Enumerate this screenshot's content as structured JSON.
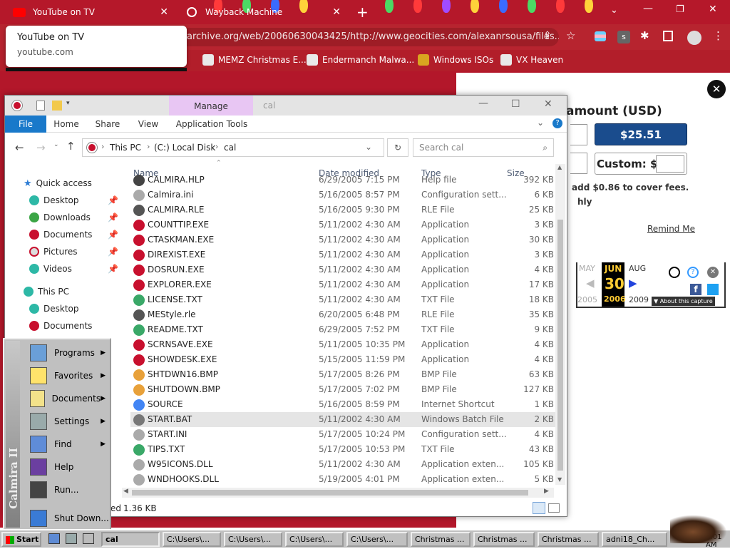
{
  "browser": {
    "tabs": [
      {
        "title": "YouTube on TV"
      },
      {
        "title": "Wayback Machine"
      }
    ],
    "hover_card": {
      "title": "YouTube on TV",
      "domain": "youtube.com"
    },
    "address": "archive.org/web/20060630043425/http://www.geocities.com/alexanrsousa/files...",
    "bookmarks": [
      "MEMZ Christmas E...",
      "Endermanch Malwa...",
      "Windows ISOs",
      "VX Heaven"
    ],
    "profile_initial": "s"
  },
  "webpage": {
    "amount_heading": "amount (USD)",
    "amount_button": "$25.51",
    "custom_label": "Custom: $",
    "fees_text": "add $0.86 to cover fees.",
    "monthly_text": "hly",
    "remind": "Remind Me",
    "wayback": {
      "prev_month": "MAY",
      "cur_month": "JUN",
      "next_month": "AUG",
      "day": "30",
      "prev_year": "2005",
      "cur_year": "2006",
      "next_year": "2009",
      "about": "About this capture"
    }
  },
  "explorer": {
    "title": "cal",
    "manage_tab": "Manage",
    "ribbon_tabs": [
      "File",
      "Home",
      "Share",
      "View",
      "Application Tools"
    ],
    "breadcrumb": [
      "This PC",
      "(C:) Local Disk",
      "cal"
    ],
    "search_placeholder": "Search cal",
    "columns": {
      "name": "Name",
      "date": "Date modified",
      "type": "Type",
      "size": "Size"
    },
    "nav": {
      "quick_access": "Quick access",
      "items": [
        "Desktop",
        "Downloads",
        "Documents",
        "Pictures",
        "Videos"
      ],
      "this_pc": "This PC",
      "pc_items": [
        "Desktop",
        "Documents"
      ]
    },
    "files": [
      {
        "name": "CALMIRA.HLP",
        "date": "6/29/2005 7:15 PM",
        "type": "Help file",
        "size": "392 KB"
      },
      {
        "name": "Calmira.ini",
        "date": "5/16/2005 8:57 PM",
        "type": "Configuration sett...",
        "size": "6 KB"
      },
      {
        "name": "CALMIRA.RLE",
        "date": "5/16/2005 9:30 PM",
        "type": "RLE File",
        "size": "25 KB"
      },
      {
        "name": "COUNTTIP.EXE",
        "date": "5/11/2002 4:30 AM",
        "type": "Application",
        "size": "3 KB"
      },
      {
        "name": "CTASKMAN.EXE",
        "date": "5/11/2002 4:30 AM",
        "type": "Application",
        "size": "30 KB"
      },
      {
        "name": "DIREXIST.EXE",
        "date": "5/11/2002 4:30 AM",
        "type": "Application",
        "size": "3 KB"
      },
      {
        "name": "DOSRUN.EXE",
        "date": "5/11/2002 4:30 AM",
        "type": "Application",
        "size": "4 KB"
      },
      {
        "name": "EXPLORER.EXE",
        "date": "5/11/2002 4:30 AM",
        "type": "Application",
        "size": "17 KB"
      },
      {
        "name": "LICENSE.TXT",
        "date": "5/11/2002 4:30 AM",
        "type": "TXT File",
        "size": "18 KB"
      },
      {
        "name": "MEStyle.rle",
        "date": "6/20/2005 6:48 PM",
        "type": "RLE File",
        "size": "35 KB"
      },
      {
        "name": "README.TXT",
        "date": "6/29/2005 7:52 PM",
        "type": "TXT File",
        "size": "9 KB"
      },
      {
        "name": "SCRNSAVE.EXE",
        "date": "5/11/2005 10:35 PM",
        "type": "Application",
        "size": "4 KB"
      },
      {
        "name": "SHOWDESK.EXE",
        "date": "5/15/2005 11:59 PM",
        "type": "Application",
        "size": "4 KB"
      },
      {
        "name": "SHTDWN16.BMP",
        "date": "5/17/2005 8:26 PM",
        "type": "BMP File",
        "size": "63 KB"
      },
      {
        "name": "SHUTDOWN.BMP",
        "date": "5/17/2005 7:02 PM",
        "type": "BMP File",
        "size": "127 KB"
      },
      {
        "name": "SOURCE",
        "date": "5/16/2005 8:59 PM",
        "type": "Internet Shortcut",
        "size": "1 KB"
      },
      {
        "name": "START.BAT",
        "date": "5/11/2002 4:30 AM",
        "type": "Windows Batch File",
        "size": "2 KB"
      },
      {
        "name": "START.INI",
        "date": "5/17/2005 10:24 PM",
        "type": "Configuration sett...",
        "size": "4 KB"
      },
      {
        "name": "TIPS.TXT",
        "date": "5/17/2005 10:53 PM",
        "type": "TXT File",
        "size": "43 KB"
      },
      {
        "name": "W95ICONS.DLL",
        "date": "5/11/2002 4:30 AM",
        "type": "Application exten...",
        "size": "105 KB"
      },
      {
        "name": "WNDHOOKS.DLL",
        "date": "5/19/2005 4:01 PM",
        "type": "Application exten...",
        "size": "5 KB"
      }
    ],
    "status_partial": "ed",
    "status_size": "1.36 KB"
  },
  "startmenu": {
    "brand": "Calmira II",
    "items": [
      "Programs",
      "Favorites",
      "Documents",
      "Settings",
      "Find",
      "Help",
      "Run...",
      "Shut Down..."
    ]
  },
  "taskbar": {
    "start": "Start",
    "buttons": [
      "cal",
      "C:\\Users\\...",
      "C:\\Users\\...",
      "C:\\Users\\...",
      "C:\\Users\\...",
      "Christmas ...",
      "Christmas ...",
      "Christmas ...",
      "adni18_Ch..."
    ],
    "clock": "7:01 AM"
  },
  "colors": {
    "browser_red": "#b5182a",
    "selection": "#e5e5e5",
    "manage_tab": "#e8c6f3",
    "file_tab": "#1979ca",
    "wayback_blue": "#1a4c8d"
  }
}
